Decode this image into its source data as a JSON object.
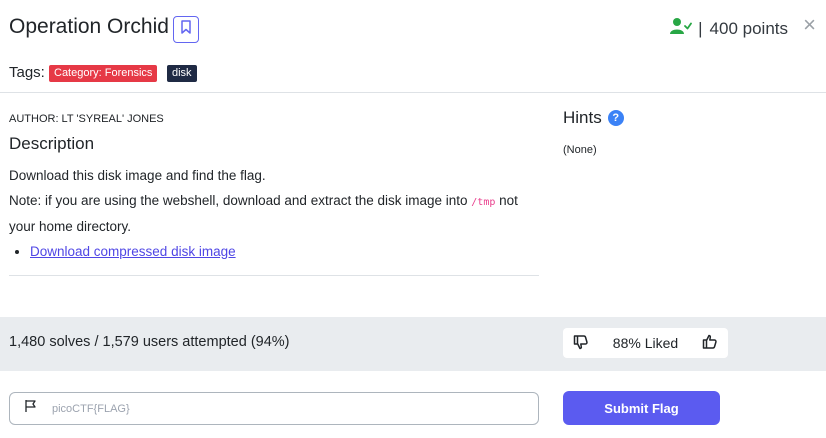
{
  "header": {
    "title": "Operation Orchid",
    "points_separator": "|",
    "points": "400 points",
    "tags_label": "Tags:",
    "tags": [
      {
        "label": "Category: Forensics",
        "color": "#e63946"
      },
      {
        "label": "disk",
        "color": "#1f2a44"
      }
    ],
    "close_glyph": "×"
  },
  "challenge": {
    "author": "AUTHOR: LT 'SYREAL' JONES",
    "description_title": "Description",
    "line1": "Download this disk image and find the flag.",
    "line2_before": "Note: if you are using the webshell, download and extract the disk image into ",
    "line2_code": "/tmp",
    "line2_after": " not your home directory.",
    "download_link": "Download compressed disk image"
  },
  "hints": {
    "title": "Hints",
    "help_glyph": "?",
    "content": "(None)"
  },
  "stats": {
    "solves_text": "1,480 solves / 1,579 users attempted (94%)",
    "liked_text": "88% Liked"
  },
  "flag_form": {
    "placeholder": "picoCTF{FLAG}",
    "submit_label": "Submit Flag"
  },
  "colors": {
    "accent": "#5b5bf0",
    "solved_green": "#28a745",
    "help_blue": "#3b82f6"
  },
  "icons": [
    "bookmark-icon",
    "user-check-icon",
    "close-icon",
    "help-icon",
    "thumbs-down-icon",
    "thumbs-up-icon",
    "flag-icon"
  ]
}
